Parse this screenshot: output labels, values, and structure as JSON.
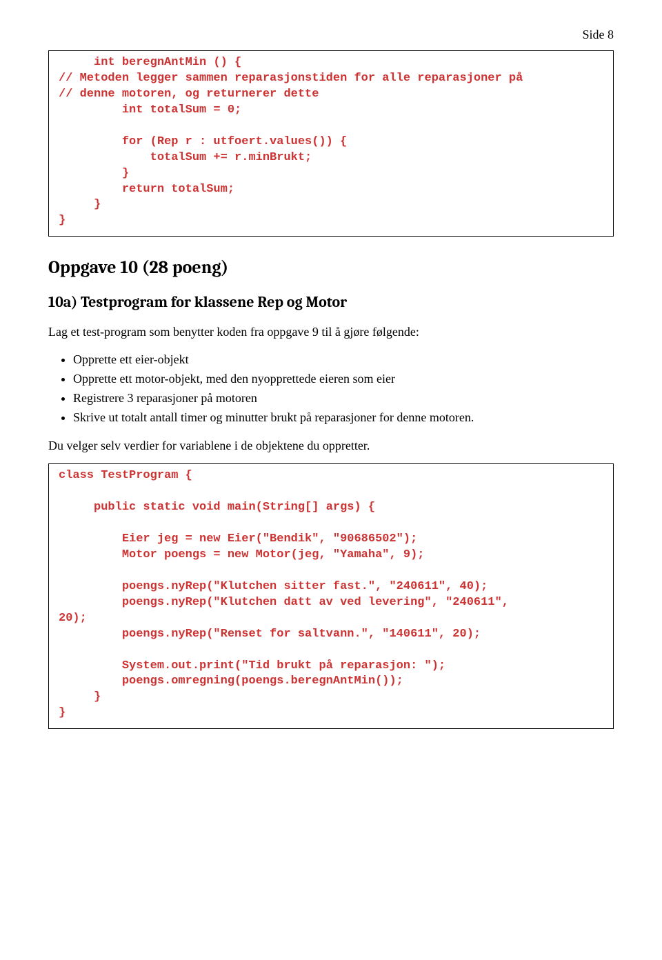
{
  "pageNumber": "Side 8",
  "codeBox1": "     int beregnAntMin () {\n// Metoden legger sammen reparasjonstiden for alle reparasjoner på\n// denne motoren, og returnerer dette\n         int totalSum = 0;\n\n         for (Rep r : utfoert.values()) {\n             totalSum += r.minBrukt;\n         }\n         return totalSum;\n     }\n}",
  "heading": "Oppgave 10 (28 poeng)",
  "subHeading": "10a) Testprogram for klassene Rep og Motor",
  "intro": "Lag et test-program som benytter koden fra oppgave 9 til å gjøre følgende:",
  "bullets": [
    "Opprette ett eier-objekt",
    "Opprette ett motor-objekt, med den nyopprettede eieren som eier",
    "Registrere 3 reparasjoner på motoren",
    "Skrive ut totalt antall timer og minutter brukt på reparasjoner for denne motoren."
  ],
  "outro": "Du velger selv verdier for variablene i de objektene du oppretter.",
  "codeBox2": "class TestProgram {\n\n     public static void main(String[] args) {\n\n         Eier jeg = new Eier(\"Bendik\", \"90686502\");\n         Motor poengs = new Motor(jeg, \"Yamaha\", 9);\n\n         poengs.nyRep(\"Klutchen sitter fast.\", \"240611\", 40);\n         poengs.nyRep(\"Klutchen datt av ved levering\", \"240611\",\n20);\n         poengs.nyRep(\"Renset for saltvann.\", \"140611\", 20);\n\n         System.out.print(\"Tid brukt på reparasjon: \");\n         poengs.omregning(poengs.beregnAntMin());\n     }\n}"
}
